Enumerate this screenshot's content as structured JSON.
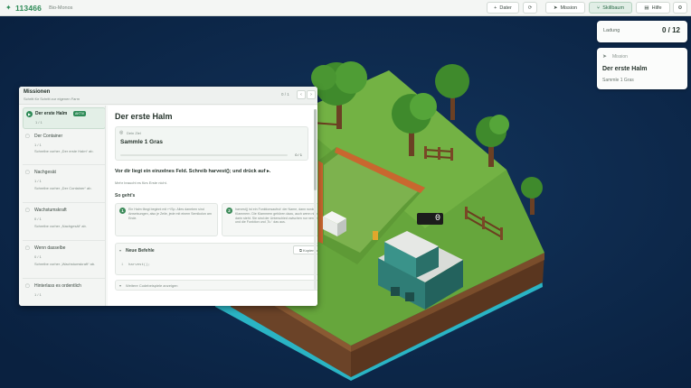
{
  "topbar": {
    "score": "113466",
    "subtitle": "Bio-Monos",
    "buttons": {
      "delete": "Dater",
      "mission": "Mission",
      "skilltree": "Skillbaum",
      "help": "Hilfe"
    }
  },
  "status_card": {
    "label": "Ladung",
    "value": "0 / 12"
  },
  "mission_card": {
    "label": "Mission",
    "title": "Der erste Halm",
    "goal": "Sammle 1 Gras"
  },
  "missions_window": {
    "title": "Missionen",
    "subtitle": "Schritt für Schritt zur eigenen Farm",
    "counter": "0 / 1",
    "list": [
      {
        "title": "Der erste Halm",
        "badge": "AKTIV",
        "progress": "1 / 1",
        "desc": ""
      },
      {
        "title": "Der Container",
        "badge": "",
        "progress": "1 / 1",
        "desc": "Schreibe vorher „Der erste Halm“ ab."
      },
      {
        "title": "Nachgesät",
        "badge": "",
        "progress": "1 / 1",
        "desc": "Schreibe vorher „Der Container“ ab."
      },
      {
        "title": "Wachstumskraft",
        "badge": "",
        "progress": "0 / 1",
        "desc": "Schreibe vorher „Nachgesät“ ab."
      },
      {
        "title": "Wenn dasselbe",
        "badge": "",
        "progress": "0 / 1",
        "desc": "Schreibe vorher „Wachstumskraft“ ab."
      },
      {
        "title": "Hinterlass es ordentlich",
        "badge": "",
        "progress": "1 / 1",
        "desc": ""
      }
    ],
    "detail": {
      "title": "Der erste Halm",
      "goal_label": "Dein Ziel",
      "goal": "Sammle 1 Gras",
      "goal_progress": "0 / 1",
      "intro": "Vor dir liegt ein einzelnes Feld. Schreib harvest(); und drück auf ▸.",
      "intro_sub": "Mehr braucht es fürs Erste nicht.",
      "howto": "So geht's",
      "steps": [
        {
          "n": "1",
          "text": "Ein Halm fängt beginnt mit ↵/Sp. Alles daneben sind Anweisungen, also je Zeile, jede mit einem Semikolon am Ende."
        },
        {
          "n": "2",
          "text": "harvest() ist ein Funktionsaufruf: der Name, dann runde Klammern. Die Klammern gehören dazu, auch wenn nichts darin steht. Sie sind der Unterschied zwischen nur nennen und die Funktion und ‚Tu ‘ das aus."
        }
      ],
      "new_commands_label": "Neue Befehle",
      "copy_label": "Kopieren",
      "code": "harvest();",
      "more": "Weitere Codebeispiele anzeigen"
    }
  },
  "machine_counter": "0",
  "colors": {
    "accent": "#2e8b57",
    "background": "#0d2747"
  }
}
